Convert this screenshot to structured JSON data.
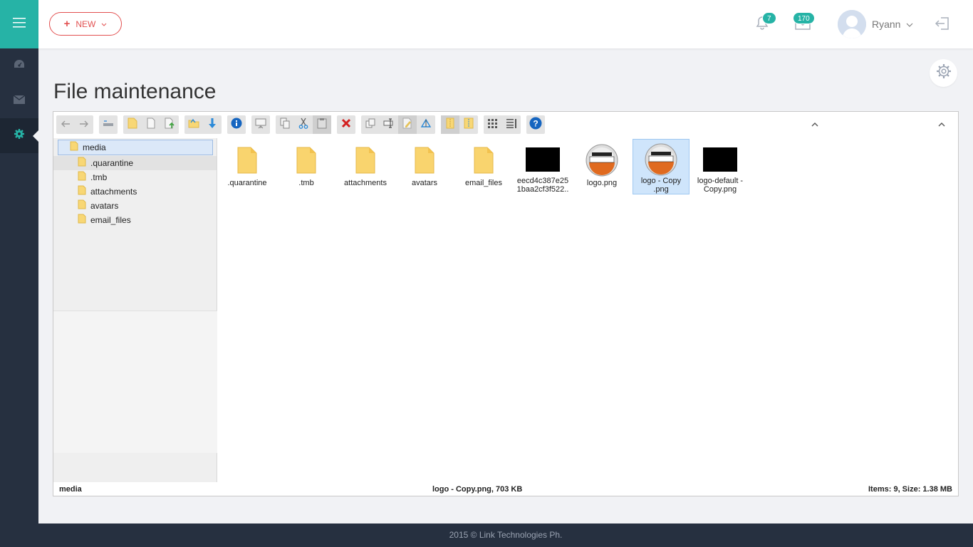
{
  "header": {
    "new_label": "NEW",
    "notifications_count": "7",
    "messages_count": "170",
    "user_name": "Ryann"
  },
  "page": {
    "title": "File maintenance"
  },
  "tree": {
    "root": "media",
    "children": [
      ".quarantine",
      ".tmb",
      "attachments",
      "avatars",
      "email_files"
    ]
  },
  "files": [
    {
      "name": ".quarantine",
      "type": "folder"
    },
    {
      "name": ".tmb",
      "type": "folder"
    },
    {
      "name": "attachments",
      "type": "folder"
    },
    {
      "name": "avatars",
      "type": "folder"
    },
    {
      "name": "email_files",
      "type": "folder"
    },
    {
      "name": "eecd4c387e251baa2cf3f522..",
      "type": "image-black"
    },
    {
      "name": "logo.png",
      "type": "image-logo"
    },
    {
      "name": "logo - Copy .png",
      "type": "image-logo",
      "selected": true
    },
    {
      "name": "logo-default - Copy.png",
      "type": "image-black"
    }
  ],
  "status": {
    "path": "media",
    "selected": "logo - Copy.png, 703 KB",
    "summary": "Items: 9, Size: 1.38 MB"
  },
  "footer": {
    "text": "2015 © Link Technologies Ph."
  },
  "colors": {
    "accent": "#26b3a6",
    "sidebar": "#263040",
    "new_button": "#e25050"
  }
}
